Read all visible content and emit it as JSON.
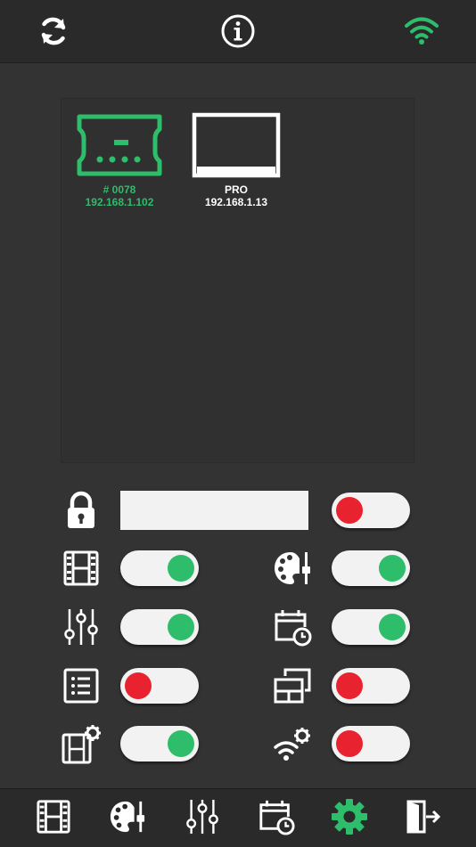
{
  "colors": {
    "accent": "#2ebd6a",
    "on": "#2ebd6a",
    "off": "#e8222e",
    "background": "#333333",
    "bar": "#2a2a2a",
    "icon": "#ffffff"
  },
  "topbar": {
    "icons": [
      "refresh-icon",
      "info-icon",
      "wifi-icon"
    ]
  },
  "devices": [
    {
      "name": "# 0078",
      "ip": "192.168.1.102",
      "selected": true,
      "icon": "controller-device-icon"
    },
    {
      "name": "PRO",
      "ip": "192.168.1.13",
      "selected": false,
      "icon": "monitor-device-icon"
    }
  ],
  "lock": {
    "password_value": "",
    "toggle_on": false,
    "icon": "lock-icon"
  },
  "toggles": [
    {
      "id": "film",
      "icon": "film-icon",
      "on": true
    },
    {
      "id": "palette",
      "icon": "palette-icon",
      "on": true
    },
    {
      "id": "sliders",
      "icon": "sliders-icon",
      "on": true
    },
    {
      "id": "calendar",
      "icon": "calendar-clock-icon",
      "on": true
    },
    {
      "id": "list",
      "icon": "list-icon",
      "on": false
    },
    {
      "id": "screens",
      "icon": "screens-icon",
      "on": false
    },
    {
      "id": "film-settings",
      "icon": "film-settings-icon",
      "on": true
    },
    {
      "id": "wifi-settings",
      "icon": "wifi-settings-icon",
      "on": false
    }
  ],
  "bottom_nav": {
    "items": [
      "film-icon",
      "palette-icon",
      "sliders-icon",
      "calendar-clock-icon",
      "gear-icon",
      "exit-icon"
    ],
    "active": "gear-icon"
  }
}
